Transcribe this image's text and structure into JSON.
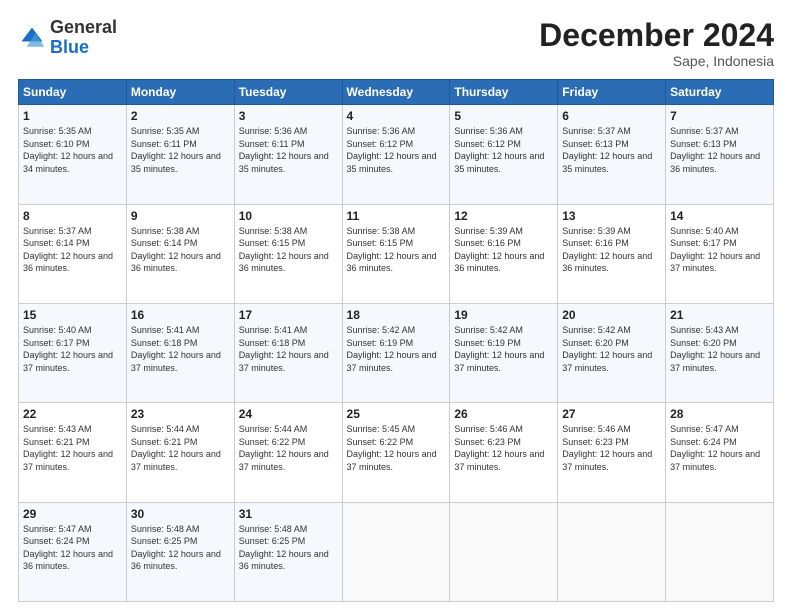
{
  "header": {
    "logo": {
      "general": "General",
      "blue": "Blue"
    },
    "title": "December 2024",
    "location": "Sape, Indonesia"
  },
  "weekdays": [
    "Sunday",
    "Monday",
    "Tuesday",
    "Wednesday",
    "Thursday",
    "Friday",
    "Saturday"
  ],
  "weeks": [
    [
      {
        "day": "1",
        "sunrise": "Sunrise: 5:35 AM",
        "sunset": "Sunset: 6:10 PM",
        "daylight": "Daylight: 12 hours and 34 minutes."
      },
      {
        "day": "2",
        "sunrise": "Sunrise: 5:35 AM",
        "sunset": "Sunset: 6:11 PM",
        "daylight": "Daylight: 12 hours and 35 minutes."
      },
      {
        "day": "3",
        "sunrise": "Sunrise: 5:36 AM",
        "sunset": "Sunset: 6:11 PM",
        "daylight": "Daylight: 12 hours and 35 minutes."
      },
      {
        "day": "4",
        "sunrise": "Sunrise: 5:36 AM",
        "sunset": "Sunset: 6:12 PM",
        "daylight": "Daylight: 12 hours and 35 minutes."
      },
      {
        "day": "5",
        "sunrise": "Sunrise: 5:36 AM",
        "sunset": "Sunset: 6:12 PM",
        "daylight": "Daylight: 12 hours and 35 minutes."
      },
      {
        "day": "6",
        "sunrise": "Sunrise: 5:37 AM",
        "sunset": "Sunset: 6:13 PM",
        "daylight": "Daylight: 12 hours and 35 minutes."
      },
      {
        "day": "7",
        "sunrise": "Sunrise: 5:37 AM",
        "sunset": "Sunset: 6:13 PM",
        "daylight": "Daylight: 12 hours and 36 minutes."
      }
    ],
    [
      {
        "day": "8",
        "sunrise": "Sunrise: 5:37 AM",
        "sunset": "Sunset: 6:14 PM",
        "daylight": "Daylight: 12 hours and 36 minutes."
      },
      {
        "day": "9",
        "sunrise": "Sunrise: 5:38 AM",
        "sunset": "Sunset: 6:14 PM",
        "daylight": "Daylight: 12 hours and 36 minutes."
      },
      {
        "day": "10",
        "sunrise": "Sunrise: 5:38 AM",
        "sunset": "Sunset: 6:15 PM",
        "daylight": "Daylight: 12 hours and 36 minutes."
      },
      {
        "day": "11",
        "sunrise": "Sunrise: 5:38 AM",
        "sunset": "Sunset: 6:15 PM",
        "daylight": "Daylight: 12 hours and 36 minutes."
      },
      {
        "day": "12",
        "sunrise": "Sunrise: 5:39 AM",
        "sunset": "Sunset: 6:16 PM",
        "daylight": "Daylight: 12 hours and 36 minutes."
      },
      {
        "day": "13",
        "sunrise": "Sunrise: 5:39 AM",
        "sunset": "Sunset: 6:16 PM",
        "daylight": "Daylight: 12 hours and 36 minutes."
      },
      {
        "day": "14",
        "sunrise": "Sunrise: 5:40 AM",
        "sunset": "Sunset: 6:17 PM",
        "daylight": "Daylight: 12 hours and 37 minutes."
      }
    ],
    [
      {
        "day": "15",
        "sunrise": "Sunrise: 5:40 AM",
        "sunset": "Sunset: 6:17 PM",
        "daylight": "Daylight: 12 hours and 37 minutes."
      },
      {
        "day": "16",
        "sunrise": "Sunrise: 5:41 AM",
        "sunset": "Sunset: 6:18 PM",
        "daylight": "Daylight: 12 hours and 37 minutes."
      },
      {
        "day": "17",
        "sunrise": "Sunrise: 5:41 AM",
        "sunset": "Sunset: 6:18 PM",
        "daylight": "Daylight: 12 hours and 37 minutes."
      },
      {
        "day": "18",
        "sunrise": "Sunrise: 5:42 AM",
        "sunset": "Sunset: 6:19 PM",
        "daylight": "Daylight: 12 hours and 37 minutes."
      },
      {
        "day": "19",
        "sunrise": "Sunrise: 5:42 AM",
        "sunset": "Sunset: 6:19 PM",
        "daylight": "Daylight: 12 hours and 37 minutes."
      },
      {
        "day": "20",
        "sunrise": "Sunrise: 5:42 AM",
        "sunset": "Sunset: 6:20 PM",
        "daylight": "Daylight: 12 hours and 37 minutes."
      },
      {
        "day": "21",
        "sunrise": "Sunrise: 5:43 AM",
        "sunset": "Sunset: 6:20 PM",
        "daylight": "Daylight: 12 hours and 37 minutes."
      }
    ],
    [
      {
        "day": "22",
        "sunrise": "Sunrise: 5:43 AM",
        "sunset": "Sunset: 6:21 PM",
        "daylight": "Daylight: 12 hours and 37 minutes."
      },
      {
        "day": "23",
        "sunrise": "Sunrise: 5:44 AM",
        "sunset": "Sunset: 6:21 PM",
        "daylight": "Daylight: 12 hours and 37 minutes."
      },
      {
        "day": "24",
        "sunrise": "Sunrise: 5:44 AM",
        "sunset": "Sunset: 6:22 PM",
        "daylight": "Daylight: 12 hours and 37 minutes."
      },
      {
        "day": "25",
        "sunrise": "Sunrise: 5:45 AM",
        "sunset": "Sunset: 6:22 PM",
        "daylight": "Daylight: 12 hours and 37 minutes."
      },
      {
        "day": "26",
        "sunrise": "Sunrise: 5:46 AM",
        "sunset": "Sunset: 6:23 PM",
        "daylight": "Daylight: 12 hours and 37 minutes."
      },
      {
        "day": "27",
        "sunrise": "Sunrise: 5:46 AM",
        "sunset": "Sunset: 6:23 PM",
        "daylight": "Daylight: 12 hours and 37 minutes."
      },
      {
        "day": "28",
        "sunrise": "Sunrise: 5:47 AM",
        "sunset": "Sunset: 6:24 PM",
        "daylight": "Daylight: 12 hours and 37 minutes."
      }
    ],
    [
      {
        "day": "29",
        "sunrise": "Sunrise: 5:47 AM",
        "sunset": "Sunset: 6:24 PM",
        "daylight": "Daylight: 12 hours and 36 minutes."
      },
      {
        "day": "30",
        "sunrise": "Sunrise: 5:48 AM",
        "sunset": "Sunset: 6:25 PM",
        "daylight": "Daylight: 12 hours and 36 minutes."
      },
      {
        "day": "31",
        "sunrise": "Sunrise: 5:48 AM",
        "sunset": "Sunset: 6:25 PM",
        "daylight": "Daylight: 12 hours and 36 minutes."
      },
      null,
      null,
      null,
      null
    ]
  ]
}
